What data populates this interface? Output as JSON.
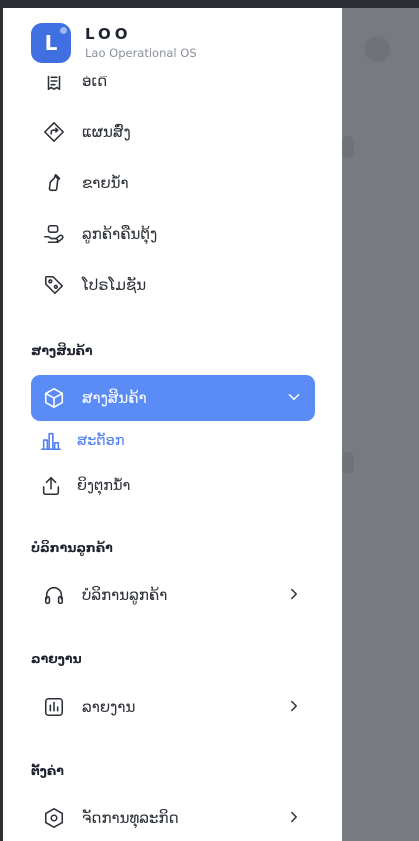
{
  "brand": {
    "logo_letter": "L",
    "title": "LOO",
    "subtitle": "Lao Operational OS"
  },
  "menu_top": [
    {
      "label": "ອໍເດີ",
      "icon": "receipt-icon"
    },
    {
      "label": "ແຜນສົ່ງ",
      "icon": "route-icon"
    },
    {
      "label": "ຂາຍນ້ຳ",
      "icon": "bottle-icon"
    },
    {
      "label": "ລູກຄ້າຄືນຕຸ້ງ",
      "icon": "hand-return-icon"
    },
    {
      "label": "ໂປຣໂມຊັນ",
      "icon": "tag-icon"
    }
  ],
  "section_products": {
    "title": "ສາງສິນຄ້າ",
    "group_label": "ສາງສິນຄ້າ",
    "sub": [
      {
        "label": "ສະຕັອກ",
        "icon": "bar-chart-icon"
      },
      {
        "label": "ຍິງຕຸກນ້ຳ",
        "icon": "upload-icon"
      }
    ]
  },
  "section_service": {
    "title": "ບໍລິການລູກຄ້າ",
    "item_label": "ບໍລິການລູກຄ້າ"
  },
  "section_reports": {
    "title": "ລາຍງານ",
    "item_label": "ລາຍງານ"
  },
  "section_settings": {
    "title": "ຕັ້ງຄ່າ",
    "item_label": "ຈັດການທຸລະກິດ"
  },
  "colors": {
    "accent": "#5b8cf6",
    "logo": "#3f6fe0",
    "overlay": "#777a7e"
  }
}
